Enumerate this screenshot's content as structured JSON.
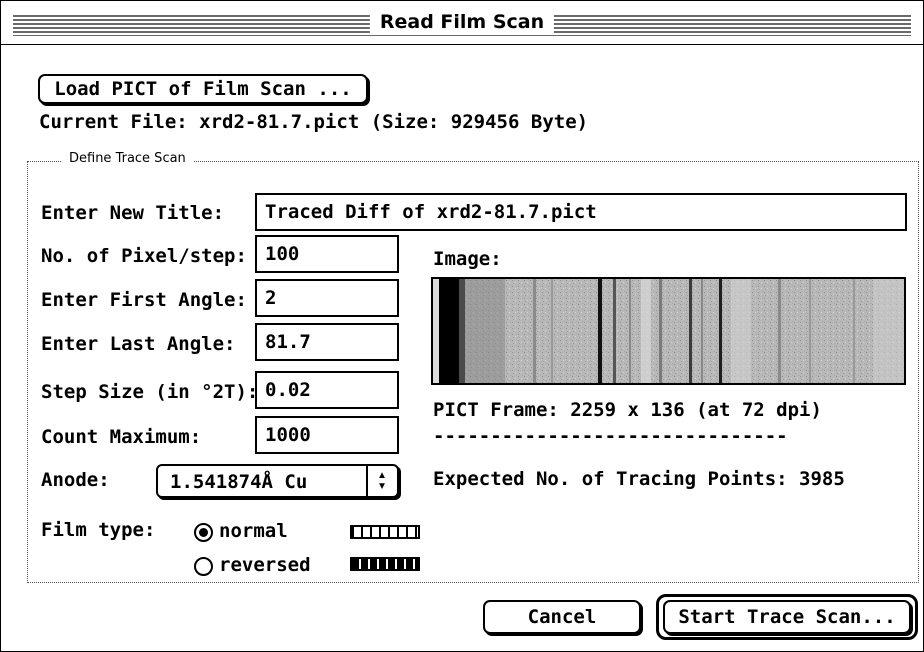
{
  "window": {
    "title": "Read Film Scan"
  },
  "load_button": {
    "label": "Load PICT of Film Scan ..."
  },
  "current_file": {
    "text": "Current File:  xrd2-81.7.pict (Size: 929456 Byte)"
  },
  "group": {
    "legend": "Define Trace Scan"
  },
  "fields": {
    "title": {
      "label": "Enter New Title:",
      "value": "Traced Diff of xrd2-81.7.pict"
    },
    "pixel_step": {
      "label": "No. of Pixel/step:",
      "value": "100"
    },
    "first_angle": {
      "label": "Enter First Angle:",
      "value": "2"
    },
    "last_angle": {
      "label": "Enter Last Angle:",
      "value": "81.7"
    },
    "step_size": {
      "label": "Step Size (in °2T):",
      "value": "0.02"
    },
    "count_max": {
      "label": "Count Maximum:",
      "value": "1000"
    }
  },
  "anode": {
    "label": "Anode:",
    "value": "1.541874Å Cu",
    "arrows": "▲▼"
  },
  "film_type": {
    "label": "Film type:",
    "options": [
      {
        "label": "normal",
        "selected": true
      },
      {
        "label": "reversed",
        "selected": false
      }
    ]
  },
  "image": {
    "label": "Image:",
    "frame_text": "PICT Frame: 2259 x 136 (at 72 dpi)",
    "separator": "-------------------------------",
    "expected_points": "Expected No. of Tracing Points: 3985"
  },
  "buttons": {
    "cancel": "Cancel",
    "start": "Start Trace Scan..."
  },
  "colors": {
    "foreground": "#000000",
    "background": "#ffffff",
    "film_gray": "#bdbdbd"
  }
}
